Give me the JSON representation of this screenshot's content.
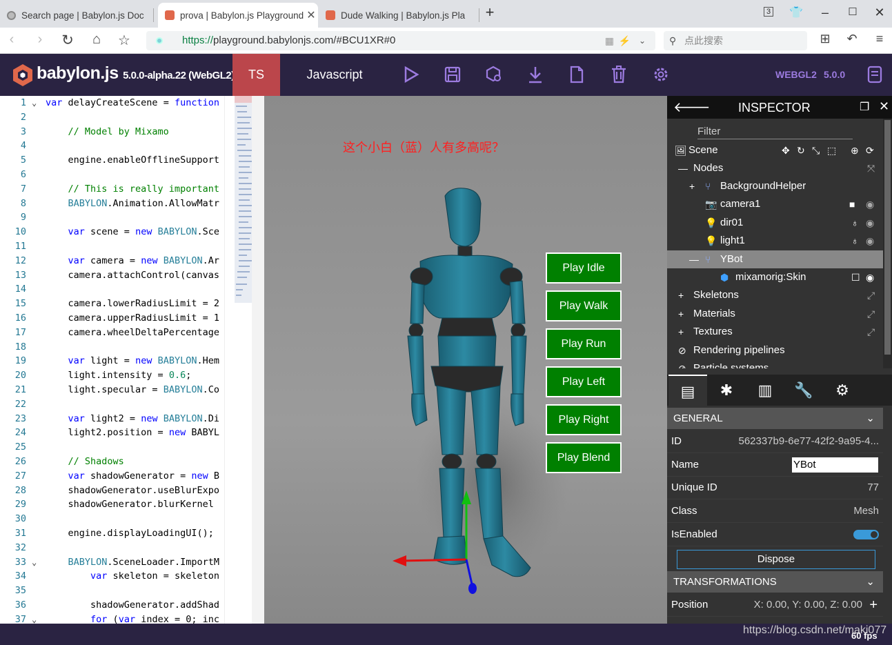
{
  "browser": {
    "tabs": [
      {
        "title": "Search page | Babylon.js Doc"
      },
      {
        "title": "prova | Babylon.js Playground"
      },
      {
        "title": "Dude Walking | Babylon.js Pla"
      }
    ],
    "tab_count": "3",
    "url_scheme": "https://",
    "url_rest": "playground.babylonjs.com/#BCU1XR#0",
    "search_placeholder": "点此搜索"
  },
  "app": {
    "brand": "babylon.js",
    "version": "5.0.0-alpha.22 (WebGL2)",
    "lang_ts": "TS",
    "lang_js": "Javascript",
    "engine_label": "WEBGL2",
    "engine_version": "5.0.0"
  },
  "editor": {
    "lines": [
      {
        "n": "1",
        "c": "var delayCreateScene = function"
      },
      {
        "n": "2",
        "c": ""
      },
      {
        "n": "3",
        "c": "    // Model by Mixamo"
      },
      {
        "n": "4",
        "c": ""
      },
      {
        "n": "5",
        "c": "    engine.enableOfflineSupport"
      },
      {
        "n": "6",
        "c": ""
      },
      {
        "n": "7",
        "c": "    // This is really important"
      },
      {
        "n": "8",
        "c": "    BABYLON.Animation.AllowMatr"
      },
      {
        "n": "9",
        "c": ""
      },
      {
        "n": "10",
        "c": "    var scene = new BABYLON.Sce"
      },
      {
        "n": "11",
        "c": ""
      },
      {
        "n": "12",
        "c": "    var camera = new BABYLON.Ar"
      },
      {
        "n": "13",
        "c": "    camera.attachControl(canvas"
      },
      {
        "n": "14",
        "c": ""
      },
      {
        "n": "15",
        "c": "    camera.lowerRadiusLimit = 2"
      },
      {
        "n": "16",
        "c": "    camera.upperRadiusLimit = 1"
      },
      {
        "n": "17",
        "c": "    camera.wheelDeltaPercentage"
      },
      {
        "n": "18",
        "c": ""
      },
      {
        "n": "19",
        "c": "    var light = new BABYLON.Hem"
      },
      {
        "n": "20",
        "c": "    light.intensity = 0.6;"
      },
      {
        "n": "21",
        "c": "    light.specular = BABYLON.Co"
      },
      {
        "n": "22",
        "c": ""
      },
      {
        "n": "23",
        "c": "    var light2 = new BABYLON.Di"
      },
      {
        "n": "24",
        "c": "    light2.position = new BABYL"
      },
      {
        "n": "25",
        "c": ""
      },
      {
        "n": "26",
        "c": "    // Shadows"
      },
      {
        "n": "27",
        "c": "    var shadowGenerator = new B"
      },
      {
        "n": "28",
        "c": "    shadowGenerator.useBlurExpo"
      },
      {
        "n": "29",
        "c": "    shadowGenerator.blurKernel "
      },
      {
        "n": "30",
        "c": ""
      },
      {
        "n": "31",
        "c": "    engine.displayLoadingUI();"
      },
      {
        "n": "32",
        "c": ""
      },
      {
        "n": "33",
        "c": "    BABYLON.SceneLoader.ImportM"
      },
      {
        "n": "34",
        "c": "        var skeleton = skeleton"
      },
      {
        "n": "35",
        "c": ""
      },
      {
        "n": "36",
        "c": "        shadowGenerator.addShad"
      },
      {
        "n": "37",
        "c": "        for (var index = 0; inc"
      }
    ]
  },
  "scene": {
    "question": "这个小白（蓝）人有多高呢？",
    "buttons": [
      "Play Idle",
      "Play Walk",
      "Play Run",
      "Play Left",
      "Play Right",
      "Play Blend"
    ]
  },
  "inspector": {
    "title": "INSPECTOR",
    "filter_placeholder": "Filter",
    "tree": {
      "scene": "Scene",
      "nodes": "Nodes",
      "background_helper": "BackgroundHelper",
      "camera": "camera1",
      "dir": "dir01",
      "light": "light1",
      "ybot": "YBot",
      "skin": "mixamorig:Skin",
      "skeletons": "Skeletons",
      "materials": "Materials",
      "textures": "Textures",
      "pipelines": "Rendering pipelines",
      "particles": "Particle systems"
    },
    "general": {
      "header": "GENERAL",
      "id_label": "ID",
      "id_value": "562337b9-6e77-42f2-9a95-4...",
      "name_label": "Name",
      "name_value": "YBot",
      "uid_label": "Unique ID",
      "uid_value": "77",
      "class_label": "Class",
      "class_value": "Mesh",
      "enabled_label": "IsEnabled",
      "dispose": "Dispose"
    },
    "transformations": {
      "header": "TRANSFORMATIONS",
      "position_label": "Position",
      "position_value": "X: 0.00, Y: 0.00, Z: 0.00"
    }
  },
  "footer": {
    "fps": "60 fps",
    "watermark": "https://blog.csdn.net/maki077"
  }
}
